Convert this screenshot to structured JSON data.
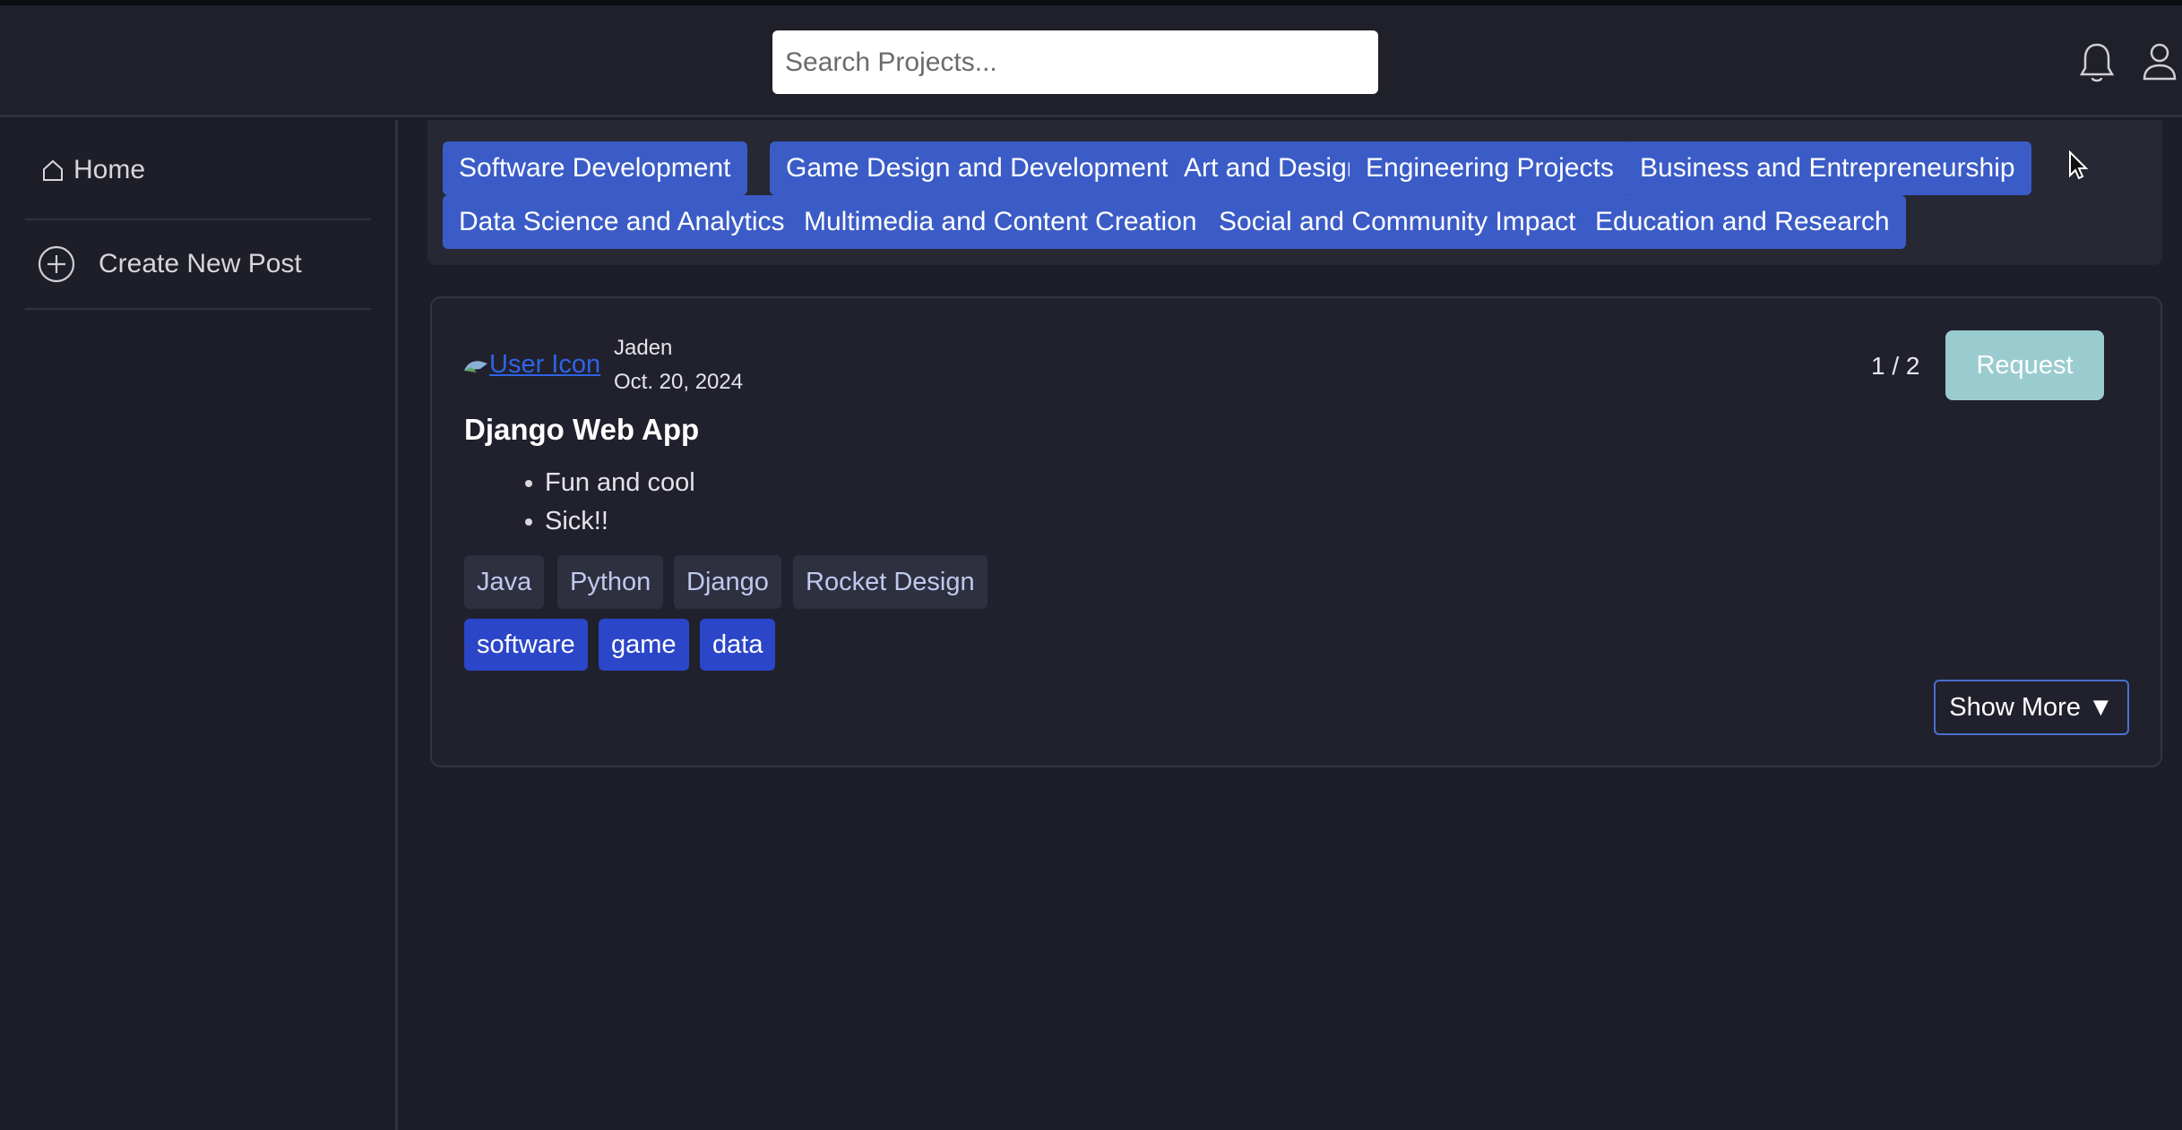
{
  "header": {
    "search_placeholder": "Search Projects...",
    "icons": [
      "bell-icon",
      "user-icon"
    ]
  },
  "sidebar": {
    "items": [
      {
        "label": "Home",
        "icon": "home-icon"
      },
      {
        "label": "Create New Post",
        "icon": "plus-circle-icon"
      }
    ]
  },
  "categories": [
    "Software Development",
    "Game Design and Development",
    "Art and Design",
    "Engineering Projects",
    "Business and Entrepreneurship",
    "Data Science and Analytics",
    "Multimedia and Content Creation",
    "Social and Community Impact",
    "Education and Research"
  ],
  "post": {
    "avatar_alt": "User Icon",
    "author": "Jaden",
    "date": "Oct. 20, 2024",
    "counter": "1 / 2",
    "request_label": "Request",
    "title": "Django Web App",
    "bullets": [
      "Fun and cool",
      "Sick!!"
    ],
    "skills": [
      "Java",
      "Python",
      "Django",
      "Rocket Design"
    ],
    "category_tags": [
      "software",
      "game",
      "data"
    ],
    "show_more_label": "Show More ▼"
  },
  "colors": {
    "background": "#1d1e28",
    "category_button": "#3b5cc7",
    "category_tag": "#2b46c8",
    "request_button": "#9acbcf",
    "link": "#2f63e8"
  }
}
